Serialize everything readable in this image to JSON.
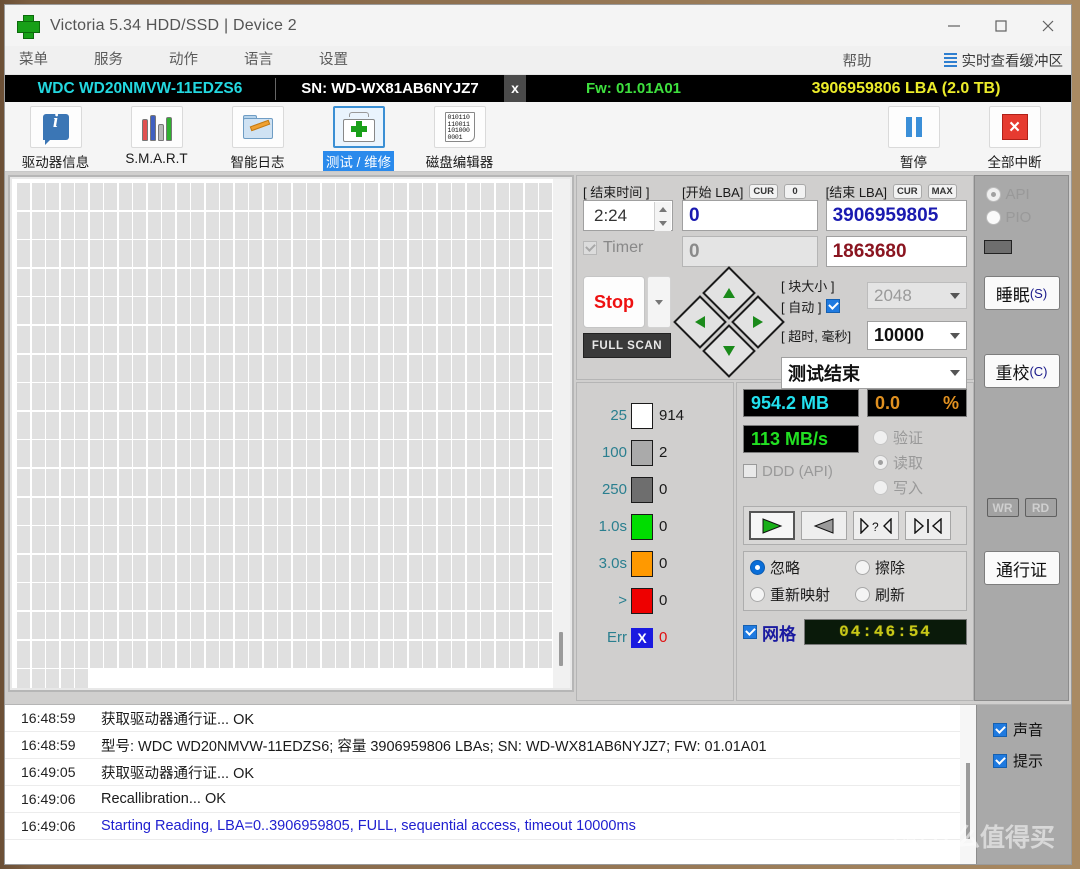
{
  "window": {
    "title": "Victoria 5.34 HDD/SSD | Device 2",
    "logo_icon": "green-cross-icon",
    "minimize": "–",
    "maximize": "□",
    "close": "×"
  },
  "menu": {
    "items": [
      {
        "label": "菜单",
        "name": "menu-main"
      },
      {
        "label": "服务",
        "name": "menu-service"
      },
      {
        "label": "动作",
        "name": "menu-actions"
      },
      {
        "label": "语言",
        "name": "menu-language"
      },
      {
        "label": "设置",
        "name": "menu-settings"
      }
    ],
    "help": "帮助",
    "buffer_view": "实时查看缓冲区"
  },
  "device": {
    "model": "WDC WD20NMVW-11EDZS6",
    "sn_prefix": "SN: ",
    "sn": "WD-WX81AB6NYJZ7",
    "close_x": "x",
    "firmware": "Fw: 01.01A01",
    "capacity": "3906959806 LBA (2.0 TB)"
  },
  "toolbar": {
    "tabs": [
      {
        "label": "驱动器信息",
        "icon": "info-icon",
        "selected": false
      },
      {
        "label": "S.M.A.R.T",
        "icon": "smart-icon",
        "selected": false
      },
      {
        "label": "智能日志",
        "icon": "folder-pencil-icon",
        "selected": false
      },
      {
        "label": "测试 / 维修",
        "icon": "medkit-icon",
        "selected": true
      },
      {
        "label": "磁盘编辑器",
        "icon": "binary-file-icon",
        "selected": false
      }
    ],
    "pause": {
      "label": "暂停",
      "icon": "pause-icon"
    },
    "stop_all": {
      "label": "全部中断",
      "icon": "stop-all-icon"
    }
  },
  "scan": {
    "end_time_label": "[ 结束时间 ]",
    "end_time_value": "2:24",
    "timer_label": "Timer",
    "timer_checked": true,
    "start_lba_label": "[开始 LBA]",
    "start_lba_cur": "CUR",
    "start_lba_cur_value": "0",
    "start_lba_value": "0",
    "start_lba_second": "0",
    "end_lba_label": "[结束 LBA]",
    "end_lba_cur": "CUR",
    "end_lba_max": "MAX",
    "end_lba_value": "3906959805",
    "end_lba_second": "1863680",
    "stop_button": "Stop",
    "full_scan": "FULL SCAN",
    "block_size_label": "[ 块大小 ]",
    "block_size_value": "2048",
    "auto_label": "[ 自动 ]",
    "auto_checked": true,
    "timeout_label": "[ 超时, 毫秒]",
    "timeout_value": "10000",
    "on_finish_value": "测试结束",
    "dpad": [
      "up-arrow-icon",
      "left-arrow-icon",
      "right-arrow-icon",
      "down-arrow-icon"
    ]
  },
  "legend": {
    "rows": [
      {
        "label": "25",
        "color": "#ffffff",
        "count": "914"
      },
      {
        "label": "100",
        "color": "#aaaaaa",
        "count": "2"
      },
      {
        "label": "250",
        "color": "#6e6e6e",
        "count": "0"
      },
      {
        "label": "1.0s",
        "color": "#00dd00",
        "count": "0"
      },
      {
        "label": "3.0s",
        "color": "#ff9900",
        "count": "0"
      },
      {
        "label": ">",
        "color": "#ee0000",
        "count": "0"
      }
    ],
    "err_label": "Err",
    "err_mark": "X",
    "err_count": "0"
  },
  "stats": {
    "size_value": "954.2 MB",
    "percent_value": "0.0",
    "percent_unit": "%",
    "speed_value": "113 MB/s",
    "ddd_label": "DDD (API)",
    "ddd_checked": false,
    "modes": [
      {
        "label": "验证",
        "selected": false
      },
      {
        "label": "读取",
        "selected": true
      },
      {
        "label": "写入",
        "selected": false
      }
    ],
    "nav_buttons": [
      {
        "name": "play-forward-button",
        "icon": "triangle-right-icon",
        "active": true
      },
      {
        "name": "play-backward-button",
        "icon": "triangle-left-icon",
        "active": false
      },
      {
        "name": "random-seek-button",
        "icon": "question-seek-icon",
        "active": false
      },
      {
        "name": "butterfly-seek-button",
        "icon": "butterfly-seek-icon",
        "active": false
      }
    ],
    "actions": [
      {
        "label": "忽略",
        "selected": true
      },
      {
        "label": "擦除",
        "selected": false
      },
      {
        "label": "重新映射",
        "selected": false
      },
      {
        "label": "刷新",
        "selected": false
      }
    ],
    "grid_label": "网格",
    "grid_checked": true,
    "elapsed": "04:46:54"
  },
  "sidebar": {
    "api_label": "API",
    "api_selected": true,
    "pio_label": "PIO",
    "pio_selected": false,
    "sleep_label": "睡眠",
    "sleep_key": "(S)",
    "recal_label": "重校",
    "recal_key": "(C)",
    "wr_label": "WR",
    "rd_label": "RD",
    "passport_label": "通行证"
  },
  "log": {
    "rows": [
      {
        "time": "16:48:59",
        "message": "获取驱动器通行证... OK",
        "style": "normal"
      },
      {
        "time": "16:48:59",
        "message": "型号: WDC WD20NMVW-11EDZS6; 容量 3906959806 LBAs; SN: WD-WX81AB6NYJZ7; FW: 01.01A01",
        "style": "normal"
      },
      {
        "time": "16:49:05",
        "message": "获取驱动器通行证... OK",
        "style": "normal"
      },
      {
        "time": "16:49:06",
        "message": "Recallibration... OK",
        "style": "normal"
      },
      {
        "time": "16:49:06",
        "message": "Starting Reading, LBA=0..3906959805, FULL, sequential access, timeout 10000ms",
        "style": "blue"
      }
    ],
    "options": [
      {
        "label": "声音",
        "checked": true
      },
      {
        "label": "提示",
        "checked": true
      }
    ]
  },
  "watermark": {
    "mark": "值",
    "text": "什么值得买"
  },
  "grid_map": {
    "columns": 38,
    "rows": 18,
    "last_row_filled": 5,
    "cell_color": "#e0e0e0"
  },
  "colors": {
    "accent": "#2a8aec",
    "device_model": "#23d8e0",
    "device_firmware": "#3ee03e",
    "device_capacity": "#ecec2a",
    "lcd_cyan": "#22e0ee",
    "lcd_green": "#22e022",
    "lcd_orange": "#e09020",
    "stop_red": "#ee1111"
  }
}
